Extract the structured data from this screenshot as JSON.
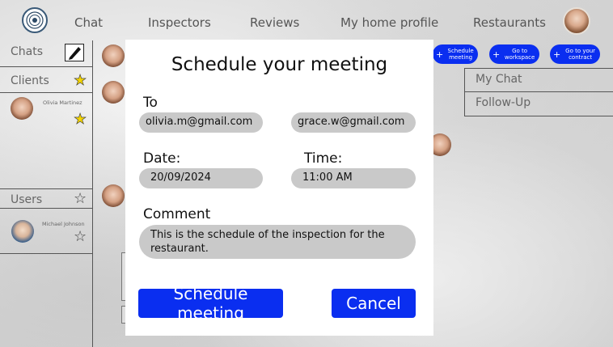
{
  "nav": {
    "items": [
      "Chat",
      "Inspectors",
      "Reviews",
      "My home profile",
      "Restaurants"
    ]
  },
  "sidebar": {
    "chats_label": "Chats",
    "clients_label": "Clients",
    "users_label": "Users",
    "client_name": "Olivia Martinez",
    "user_name": "Michael Johnson"
  },
  "actions": {
    "schedule": "Schedule meeting",
    "workspace": "Go to workspace",
    "contract": "Go to your contract"
  },
  "right_panel": {
    "my_chat": "My Chat",
    "follow_up": "Follow-Up"
  },
  "modal": {
    "title": "Schedule your meeting",
    "to_label": "To",
    "to_primary": "olivia.m@gmail.com",
    "to_secondary": "grace.w@gmail.com",
    "date_label": "Date:",
    "date_value": "20/09/2024",
    "time_label": "Time:",
    "time_value": "11:00 AM",
    "comment_label": "Comment",
    "comment_value": "This is the schedule of the inspection for the restaurant.",
    "schedule_button": "Schedule meeting",
    "cancel_button": "Cancel"
  },
  "colors": {
    "accent": "#0a2ef0",
    "pill_gray": "#c9c9c9",
    "star_yellow": "#f4d400"
  }
}
